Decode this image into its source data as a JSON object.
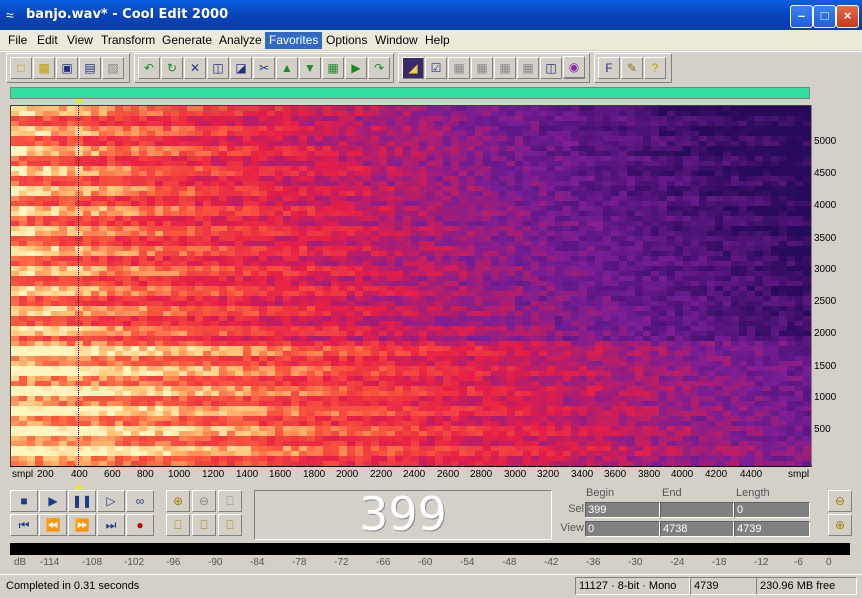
{
  "window": {
    "title": "banjo.wav* - Cool Edit 2000",
    "controls": [
      "minimize",
      "maximize",
      "close"
    ]
  },
  "menu": [
    "File",
    "Edit",
    "View",
    "Transform",
    "Generate",
    "Analyze",
    "Favorites",
    "Options",
    "Window",
    "Help"
  ],
  "menu_active": "Favorites",
  "toolbar": {
    "groups": [
      [
        "new-icon",
        "open-icon",
        "save-icon",
        "save-all-icon",
        "close-file-icon"
      ],
      [
        "undo-icon",
        "repeat-icon",
        "cut-tool-icon",
        "copy-icon",
        "paste-icon",
        "scissors-icon",
        "trim-icon",
        "mix-paste-icon",
        "paste-new-icon",
        "convert-icon"
      ],
      [
        "spectral-view-icon",
        "toggle-icon",
        "grid1-icon",
        "grid2-icon",
        "grid3-icon",
        "grid4-icon",
        "info-icon",
        "properties-icon",
        "cd-icon"
      ],
      [
        "favorites-icon",
        "script-icon",
        "help-icon"
      ]
    ]
  },
  "frequency_axis": [
    "5000",
    "4500",
    "4000",
    "3500",
    "3000",
    "2500",
    "2000",
    "1500",
    "1000",
    "500"
  ],
  "time_axis": [
    "smpl",
    "200",
    "400",
    "600",
    "800",
    "1000",
    "1200",
    "1400",
    "1600",
    "1800",
    "2000",
    "2200",
    "2400",
    "2600",
    "2800",
    "3000",
    "3200",
    "3400",
    "3600",
    "3800",
    "4000",
    "4200",
    "4400",
    "smpl"
  ],
  "time_display": "399",
  "selection": {
    "headers": {
      "begin": "Begin",
      "end": "End",
      "length": "Length"
    },
    "sel_label": "Sel",
    "view_label": "View",
    "sel": {
      "begin": "399",
      "end": "",
      "length": "0"
    },
    "view": {
      "begin": "0",
      "end": "4738",
      "length": "4739"
    }
  },
  "level_axis": [
    "dB",
    "-114",
    "-108",
    "-102",
    "-96",
    "-90",
    "-84",
    "-78",
    "-72",
    "-66",
    "-60",
    "-54",
    "-48",
    "-42",
    "-36",
    "-30",
    "-24",
    "-18",
    "-12",
    "-6",
    "0"
  ],
  "status": {
    "message": "Completed in 0.31 seconds",
    "format": "11127 · 8-bit · Mono",
    "samples": "4739",
    "free_space": "230.96 MB free"
  },
  "colors": {
    "spectrogram_hot": "#fff0a0",
    "spectrogram_mid": "#e82040",
    "spectrogram_low": "#5a1a8a",
    "overview": "#2ee0a0",
    "titlebar": "#0842b5"
  }
}
